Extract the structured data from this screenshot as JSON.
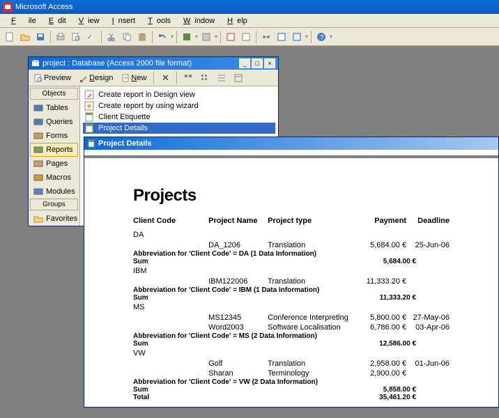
{
  "app": {
    "title": "Microsoft Access"
  },
  "menubar": [
    "File",
    "Edit",
    "View",
    "Insert",
    "Tools",
    "Window",
    "Help"
  ],
  "db_window": {
    "title": "project : Database (Access 2000 file format)",
    "toolbar": {
      "preview": "Preview",
      "design": "Design",
      "new": "New"
    },
    "sidebar": {
      "objects_label": "Objects",
      "items": [
        {
          "label": "Tables",
          "color": "#4a7dbd"
        },
        {
          "label": "Queries",
          "color": "#4a7dbd"
        },
        {
          "label": "Forms",
          "color": "#c96"
        },
        {
          "label": "Reports",
          "color": "#7a9d5e",
          "active": true
        },
        {
          "label": "Pages",
          "color": "#d0a060"
        },
        {
          "label": "Macros",
          "color": "#c8a030"
        },
        {
          "label": "Modules",
          "color": "#6080c0"
        }
      ],
      "groups_label": "Groups",
      "favorites_label": "Favorites"
    },
    "content": [
      {
        "label": "Create report in Design view",
        "icon": "design"
      },
      {
        "label": "Create report by using wizard",
        "icon": "wizard"
      },
      {
        "label": "Client Etiquette",
        "icon": "report"
      },
      {
        "label": "Project Details",
        "icon": "report",
        "selected": true
      }
    ]
  },
  "report": {
    "title": "Project Details",
    "heading": "Projects",
    "columns": {
      "client_code": "Client Code",
      "project_name": "Project Name",
      "project_type": "Project type",
      "payment": "Payment",
      "deadline": "Deadline"
    },
    "groups": [
      {
        "code": "DA",
        "rows": [
          {
            "name": "DA_1206",
            "type": "Translation",
            "payment": "5,684.00 €",
            "deadline": "25-Jun-06"
          }
        ],
        "summary_text": "Abbreviation for 'Client Code' = DA (1 Data Information)",
        "sum_label": "Sum",
        "sum_value": "5,684.00 €"
      },
      {
        "code": "IBM",
        "rows": [
          {
            "name": "IBM122006",
            "type": "Translation",
            "payment": "11,333.20 €",
            "deadline": ""
          }
        ],
        "summary_text": "Abbreviation for 'Client Code' = IBM (1 Data Information)",
        "sum_label": "Sum",
        "sum_value": "11,333.20 €"
      },
      {
        "code": "MS",
        "rows": [
          {
            "name": "MS12345",
            "type": "Conference Interpreting",
            "payment": "5,800.00 €",
            "deadline": "27-May-06"
          },
          {
            "name": "Word2003",
            "type": "Software Localisation",
            "payment": "6,786.00 €",
            "deadline": "03-Apr-06"
          }
        ],
        "summary_text": "Abbreviation for 'Client Code' = MS (2 Data Information)",
        "sum_label": "Sum",
        "sum_value": "12,586.00 €"
      },
      {
        "code": "VW",
        "rows": [
          {
            "name": "Golf",
            "type": "Translation",
            "payment": "2,958.00 €",
            "deadline": "01-Jun-06"
          },
          {
            "name": "Sharan",
            "type": "Terminology",
            "payment": "2,900.00 €",
            "deadline": ""
          }
        ],
        "summary_text": "Abbreviation for 'Client Code' = VW (2 Data Information)",
        "sum_label": "Sum",
        "sum_value": "5,858.00 €"
      }
    ],
    "total_label": "Total",
    "total_value": "35,461.20 €"
  }
}
